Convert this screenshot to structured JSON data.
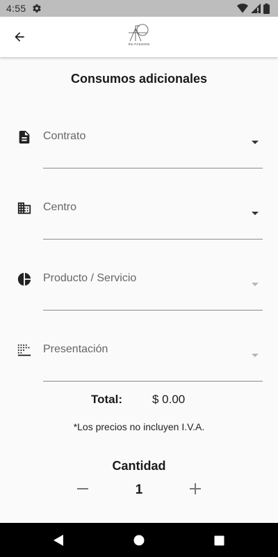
{
  "status_bar": {
    "time": "4:55"
  },
  "header": {
    "logo_text": "the FASHION"
  },
  "main": {
    "title": "Consumos adicionales",
    "fields": [
      {
        "label": "Contrato",
        "icon": "document-icon"
      },
      {
        "label": "Centro",
        "icon": "building-icon"
      },
      {
        "label": "Producto / Servicio",
        "icon": "pie-chart-icon"
      },
      {
        "label": "Presentación",
        "icon": "dots-grid-icon"
      }
    ],
    "total_label": "Total:",
    "total_value": "$ 0.00",
    "disclaimer": "*Los precios no incluyen I.V.A.",
    "quantity_label": "Cantidad",
    "quantity_value": "1",
    "minus_symbol": "−",
    "plus_symbol": "+"
  }
}
